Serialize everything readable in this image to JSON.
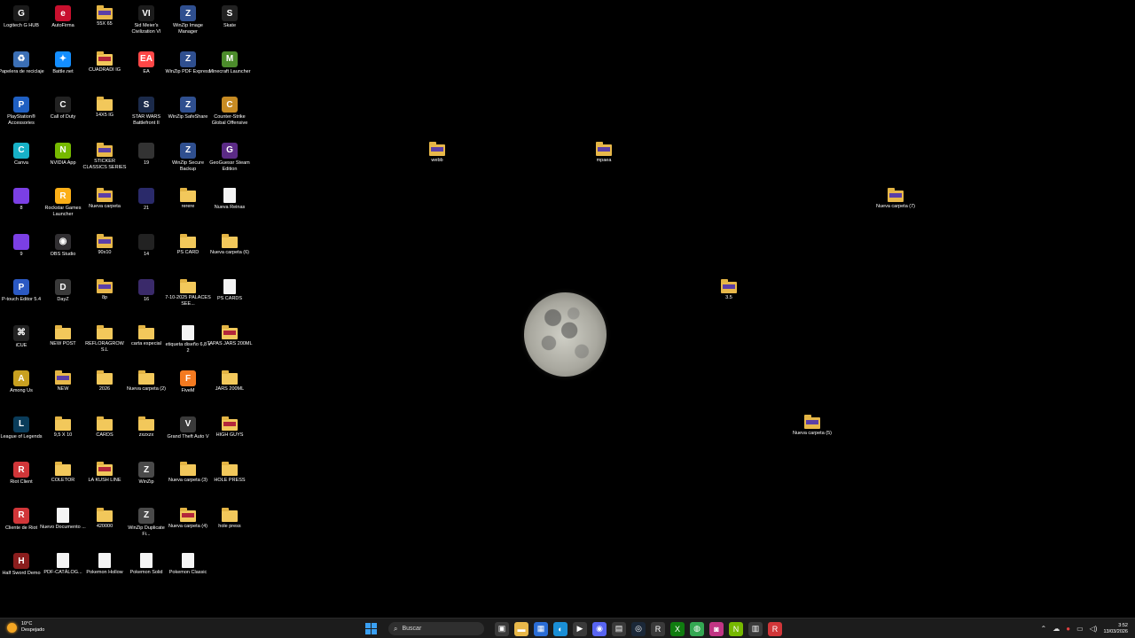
{
  "desktop_icons": [
    {
      "label": "Logitech G HUB",
      "type": "app",
      "color": "#1b1b1b",
      "glyph": "G"
    },
    {
      "label": "Papelera de reciclaje",
      "type": "app",
      "color": "#3b6fb5",
      "glyph": "♻"
    },
    {
      "label": "PlayStation® Accessories",
      "type": "app",
      "color": "#1f5fc2",
      "glyph": "P"
    },
    {
      "label": "Canva",
      "type": "app",
      "color": "#17b1c7",
      "glyph": "C"
    },
    {
      "label": "8",
      "type": "app",
      "color": "#7b3fe4",
      "glyph": ""
    },
    {
      "label": "9",
      "type": "app",
      "color": "#7b3fe4",
      "glyph": ""
    },
    {
      "label": "P-touch Editor 5.4",
      "type": "app",
      "color": "#2b59c3",
      "glyph": "P"
    },
    {
      "label": "iCUE",
      "type": "app",
      "color": "#222",
      "glyph": "⌘"
    },
    {
      "label": "Among Us",
      "type": "app",
      "color": "#c8a020",
      "glyph": "A"
    },
    {
      "label": "League of Legends",
      "type": "app",
      "color": "#0a3c5a",
      "glyph": "L"
    },
    {
      "label": "Riot Client",
      "type": "app",
      "color": "#d13639",
      "glyph": "R"
    },
    {
      "label": "Cliente de Riot",
      "type": "app",
      "color": "#d13639",
      "glyph": "R"
    },
    {
      "label": "Half Sword Demo",
      "type": "app",
      "color": "#8a1d1d",
      "glyph": "H"
    },
    {
      "label": "AutoFirma",
      "type": "app",
      "color": "#c8102e",
      "glyph": "e"
    },
    {
      "label": "Battle.net",
      "type": "app",
      "color": "#148eff",
      "glyph": "✦"
    },
    {
      "label": "Call of Duty",
      "type": "app",
      "color": "#222",
      "glyph": "C"
    },
    {
      "label": "NVIDIA App",
      "type": "app",
      "color": "#76b900",
      "glyph": "N"
    },
    {
      "label": "Rockstar Games Launcher",
      "type": "app",
      "color": "#fcaf17",
      "glyph": "R"
    },
    {
      "label": "OBS Studio",
      "type": "app",
      "color": "#302e31",
      "glyph": "◉"
    },
    {
      "label": "DayZ",
      "type": "app",
      "color": "#3a3a3a",
      "glyph": "D"
    },
    {
      "label": "NEW POST",
      "type": "folder"
    },
    {
      "label": "NEW",
      "type": "folder-dark"
    },
    {
      "label": "9,5 X 10",
      "type": "folder"
    },
    {
      "label": "COLETOR",
      "type": "folder"
    },
    {
      "label": "Nuevo Documento ...",
      "type": "doc"
    },
    {
      "label": "PDF-CATÁLOG...",
      "type": "doc"
    },
    {
      "label": "55X 65",
      "type": "folder-dark"
    },
    {
      "label": "CUADRADI IG",
      "type": "folder-red"
    },
    {
      "label": "14X5 IG",
      "type": "folder"
    },
    {
      "label": "STICKER CLASSICS SERIES",
      "type": "folder-dark"
    },
    {
      "label": "Nueva carpeta",
      "type": "folder-dark"
    },
    {
      "label": "90x10",
      "type": "folder-dark"
    },
    {
      "label": "8p",
      "type": "folder-dark"
    },
    {
      "label": "REFLORAGROW S.L",
      "type": "folder"
    },
    {
      "label": "2026",
      "type": "folder"
    },
    {
      "label": "CARDS",
      "type": "folder"
    },
    {
      "label": "LA KUSH LINE",
      "type": "folder-red"
    },
    {
      "label": "420000",
      "type": "folder"
    },
    {
      "label": "Pokemon Hollow",
      "type": "doc"
    },
    {
      "label": "Sid Meier's Civilization VI",
      "type": "app",
      "color": "#1c1c1c",
      "glyph": "VI"
    },
    {
      "label": "EA",
      "type": "app",
      "color": "#ff4747",
      "glyph": "EA"
    },
    {
      "label": "STAR WARS Battlefront II",
      "type": "app",
      "color": "#1b2a4a",
      "glyph": "S"
    },
    {
      "label": "19",
      "type": "app",
      "color": "#333",
      "glyph": ""
    },
    {
      "label": "21",
      "type": "app",
      "color": "#2a2a6a",
      "glyph": ""
    },
    {
      "label": "14",
      "type": "app",
      "color": "#222",
      "glyph": ""
    },
    {
      "label": "16",
      "type": "app",
      "color": "#3a2a6a",
      "glyph": ""
    },
    {
      "label": "carta especial",
      "type": "folder"
    },
    {
      "label": "Nueva carpeta (2)",
      "type": "folder"
    },
    {
      "label": "zxzxzx",
      "type": "folder"
    },
    {
      "label": "WinZip",
      "type": "app",
      "color": "#4a4a4a",
      "glyph": "Z"
    },
    {
      "label": "WinZip Duplicate Fi...",
      "type": "app",
      "color": "#4a4a4a",
      "glyph": "Z"
    },
    {
      "label": "Pokemon Solid",
      "type": "doc"
    },
    {
      "label": "WinZip Image Manager",
      "type": "app",
      "color": "#2f4f8f",
      "glyph": "Z"
    },
    {
      "label": "WinZip PDF Express",
      "type": "app",
      "color": "#2f4f8f",
      "glyph": "Z"
    },
    {
      "label": "WinZip SafeShare",
      "type": "app",
      "color": "#2f4f8f",
      "glyph": "Z"
    },
    {
      "label": "WinZip Secure Backup",
      "type": "app",
      "color": "#2f4f8f",
      "glyph": "Z"
    },
    {
      "label": "rerere",
      "type": "folder"
    },
    {
      "label": "PS CARD",
      "type": "folder"
    },
    {
      "label": "7-10-2025 PALACES SEE...",
      "type": "folder"
    },
    {
      "label": "etiqueta diseño 6,8 x 2",
      "type": "doc"
    },
    {
      "label": "FiveM",
      "type": "app",
      "color": "#f47a20",
      "glyph": "F"
    },
    {
      "label": "Grand Theft Auto V",
      "type": "app",
      "color": "#3a3a3a",
      "glyph": "V"
    },
    {
      "label": "Nueva carpeta (3)",
      "type": "folder"
    },
    {
      "label": "Nueva carpeta (4)",
      "type": "folder-red"
    },
    {
      "label": "Pokemon Classic",
      "type": "doc"
    },
    {
      "label": "Skate",
      "type": "app",
      "color": "#222",
      "glyph": "S"
    },
    {
      "label": "Minecraft Launcher",
      "type": "app",
      "color": "#4c8c2b",
      "glyph": "M"
    },
    {
      "label": "Counter-Strike Global Offensive",
      "type": "app",
      "color": "#c78b23",
      "glyph": "C"
    },
    {
      "label": "GeoGuessr Steam Edition",
      "type": "app",
      "color": "#5b2a86",
      "glyph": "G"
    },
    {
      "label": "Nueva Reinas",
      "type": "doc"
    },
    {
      "label": "Nueva carpeta (6)",
      "type": "folder"
    },
    {
      "label": "PS CARDS",
      "type": "doc"
    },
    {
      "label": "TAPAS JARS 200ML",
      "type": "folder-red"
    },
    {
      "label": "JARS 200ML",
      "type": "folder"
    },
    {
      "label": "HIGH GUYS",
      "type": "folder-red"
    },
    {
      "label": "HOLE PRESS",
      "type": "folder"
    },
    {
      "label": "hole press",
      "type": "folder"
    }
  ],
  "free_icons": [
    {
      "label": "webb",
      "type": "folder-dark"
    },
    {
      "label": "mpaea",
      "type": "folder-dark"
    },
    {
      "label": "Nueva carpeta (7)",
      "type": "folder-dark"
    },
    {
      "label": "3.5",
      "type": "folder-dark"
    },
    {
      "label": "Nueva carpeta (5)",
      "type": "folder-dark"
    }
  ],
  "taskbar": {
    "weather_temp": "10°C",
    "weather_desc": "Despejado",
    "search_placeholder": "Buscar",
    "pinned": [
      {
        "name": "task-view",
        "glyph": "▣",
        "color": "#3a3a3a"
      },
      {
        "name": "file-explorer",
        "glyph": "▬",
        "color": "#e8b84a"
      },
      {
        "name": "store",
        "glyph": "▦",
        "color": "#2a6dd6"
      },
      {
        "name": "edge",
        "glyph": "◐",
        "color": "#1a8fd6"
      },
      {
        "name": "media",
        "glyph": "▶",
        "color": "#3a3a3a"
      },
      {
        "name": "discord",
        "glyph": "◉",
        "color": "#5865f2"
      },
      {
        "name": "calculator",
        "glyph": "▤",
        "color": "#3a3a3a"
      },
      {
        "name": "steam",
        "glyph": "◎",
        "color": "#1b2838"
      },
      {
        "name": "rockstar",
        "glyph": "R",
        "color": "#3a3a3a"
      },
      {
        "name": "xbox",
        "glyph": "X",
        "color": "#107c10"
      },
      {
        "name": "chrome",
        "glyph": "◍",
        "color": "#34a853"
      },
      {
        "name": "instagram",
        "glyph": "◙",
        "color": "#c13584"
      },
      {
        "name": "nvidia",
        "glyph": "N",
        "color": "#76b900"
      },
      {
        "name": "apps",
        "glyph": "▥",
        "color": "#3a3a3a"
      },
      {
        "name": "riot",
        "glyph": "R",
        "color": "#d13639"
      }
    ],
    "clock_time": "3:52",
    "clock_date": "13/03/2026"
  }
}
